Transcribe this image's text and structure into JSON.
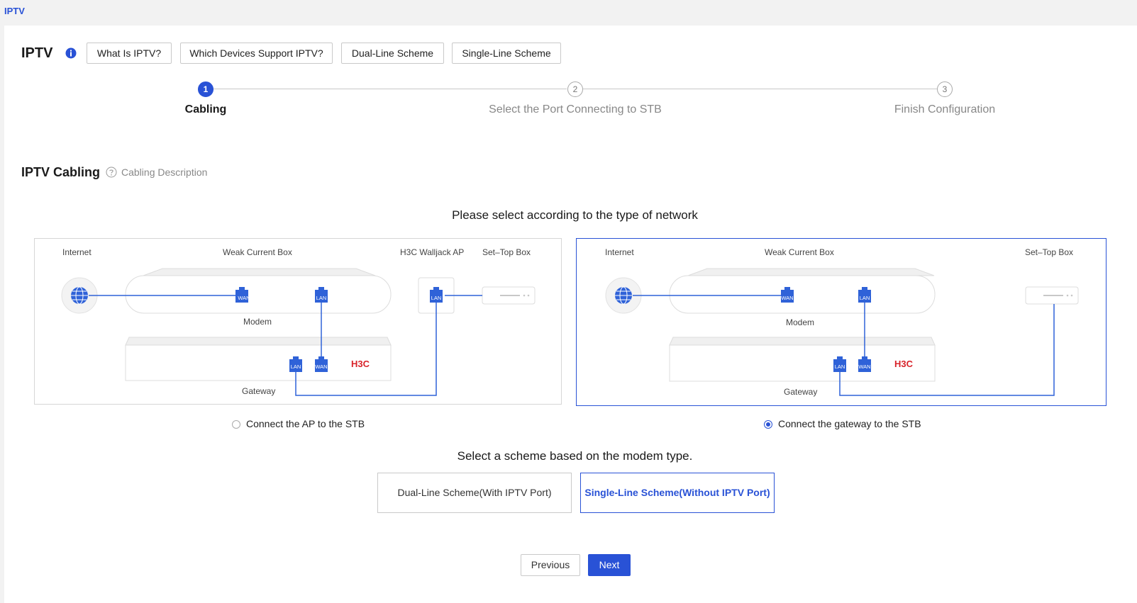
{
  "top_tab": "IPTV",
  "header": {
    "title": "IPTV",
    "buttons": [
      "What Is IPTV?",
      "Which Devices Support IPTV?",
      "Dual-Line Scheme",
      "Single-Line Scheme"
    ]
  },
  "steps": [
    {
      "number": "1",
      "label": "Cabling",
      "active": true
    },
    {
      "number": "2",
      "label": "Select the Port Connecting to STB",
      "active": false
    },
    {
      "number": "3",
      "label": "Finish Configuration",
      "active": false
    }
  ],
  "section": {
    "title": "IPTV Cabling",
    "help": "Cabling Description"
  },
  "network_prompt": "Please select according to the type of network",
  "diagrams": {
    "left": {
      "internet": "Internet",
      "weak_box": "Weak Current Box",
      "ap": "H3C Walljack AP",
      "stb": "Set–Top Box",
      "modem": "Modem",
      "gateway": "Gateway",
      "ports": {
        "wan": "WAN",
        "lan": "LAN"
      },
      "brand": "H3C",
      "option": "Connect the AP to the STB",
      "selected": false
    },
    "right": {
      "internet": "Internet",
      "weak_box": "Weak Current Box",
      "stb": "Set–Top Box",
      "modem": "Modem",
      "gateway": "Gateway",
      "ports": {
        "wan": "WAN",
        "lan": "LAN"
      },
      "brand": "H3C",
      "option": "Connect the gateway to the STB",
      "selected": true
    }
  },
  "scheme_prompt": "Select a scheme based on the modem type.",
  "schemes": [
    {
      "label": "Dual-Line Scheme(With IPTV Port)",
      "selected": false
    },
    {
      "label": "Single-Line Scheme(Without IPTV Port)",
      "selected": true
    }
  ],
  "nav": {
    "previous": "Previous",
    "next": "Next"
  },
  "colors": {
    "accent": "#2952d6",
    "brand_red": "#d8232a",
    "port_blue": "#2f62d8"
  }
}
